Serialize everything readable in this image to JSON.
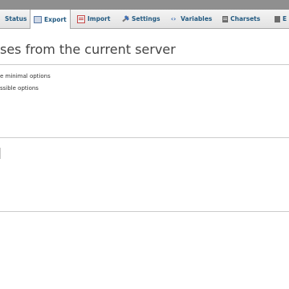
{
  "tabs": [
    {
      "label": "Status",
      "icon": "status-icon"
    },
    {
      "label": "Export",
      "icon": "export-icon",
      "active": true
    },
    {
      "label": "Import",
      "icon": "import-icon"
    },
    {
      "label": "Settings",
      "icon": "settings-icon"
    },
    {
      "label": "Variables",
      "icon": "variables-icon"
    },
    {
      "label": "Charsets",
      "icon": "charsets-icon"
    },
    {
      "label": "E",
      "icon": "engines-icon"
    }
  ],
  "page": {
    "title": "ses from the current server",
    "options": [
      "e minimal options",
      "ssible options"
    ]
  },
  "colors": {
    "tab_text": "#235a81",
    "topbar": "#8f8f8f",
    "divider": "#cccccc"
  }
}
